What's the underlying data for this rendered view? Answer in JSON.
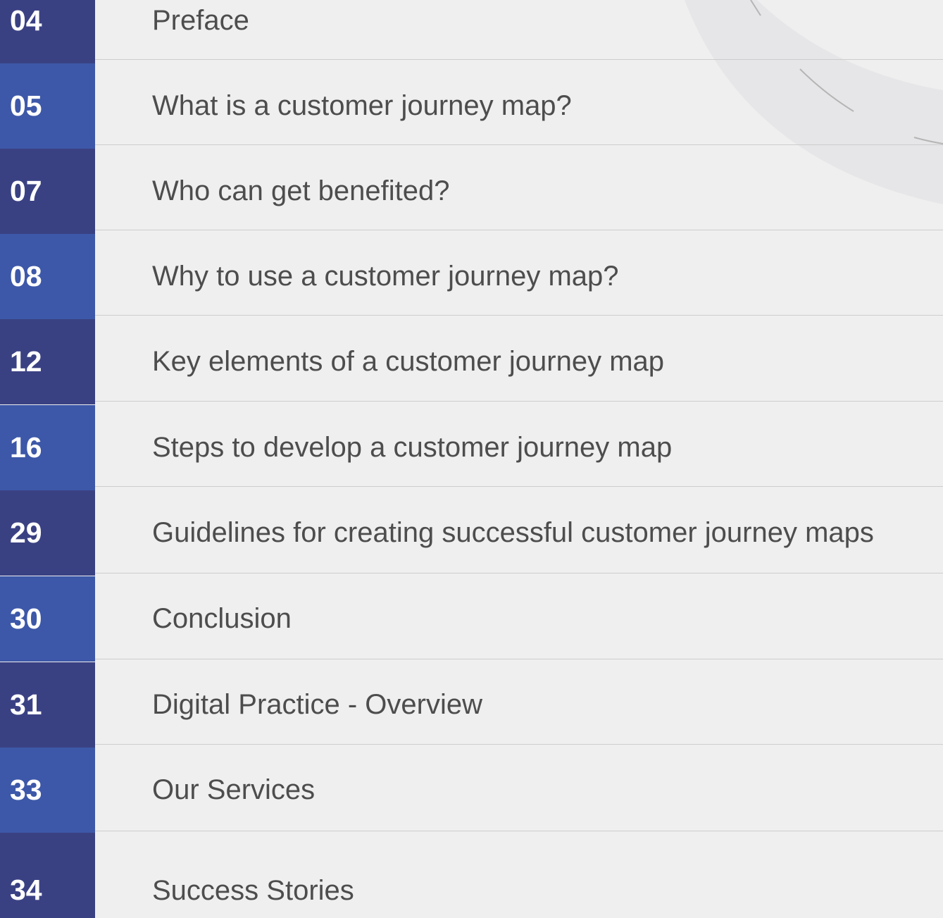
{
  "colors": {
    "background": "#efefef",
    "number_dark": "#3a4183",
    "number_light": "#3d58a8",
    "title_text": "#4d4d4d",
    "divider": "#cdcdcd"
  },
  "toc": {
    "items": [
      {
        "page": "04",
        "title": "Preface"
      },
      {
        "page": "05",
        "title": "What is a customer journey map?"
      },
      {
        "page": "07",
        "title": "Who can get benefited?"
      },
      {
        "page": "08",
        "title": "Why to use a customer journey map?"
      },
      {
        "page": "12",
        "title": "Key elements of a customer journey map"
      },
      {
        "page": "16",
        "title": "Steps to develop a customer journey map"
      },
      {
        "page": "29",
        "title": "Guidelines for creating successful customer journey maps"
      },
      {
        "page": "30",
        "title": "Conclusion"
      },
      {
        "page": "31",
        "title": "Digital Practice - Overview"
      },
      {
        "page": "33",
        "title": "Our Services"
      },
      {
        "page": "34",
        "title": "Success Stories"
      }
    ]
  }
}
